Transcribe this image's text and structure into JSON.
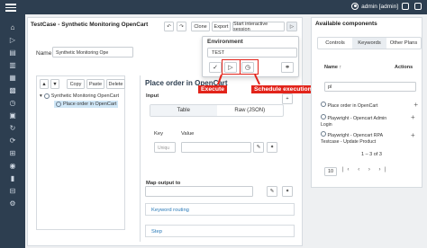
{
  "header": {
    "user": "admin [admin]"
  },
  "sidebar": {
    "icons": [
      "home-icon",
      "play-icon",
      "document-icon",
      "document-icon",
      "book-icon",
      "building-icon",
      "clock-icon",
      "database-icon",
      "loop-icon",
      "refresh-icon",
      "hierarchy-icon",
      "user-icon",
      "chart-icon",
      "grid-icon",
      "gear-icon"
    ]
  },
  "testcase": {
    "title": "TestCase - Synthetic Monitoring OpenCart",
    "toolbar": {
      "undo": "↶",
      "redo": "↷",
      "clone": "Clone",
      "export": "Export",
      "interactive": "Start interactive session",
      "play": "▷"
    },
    "name_label": "Name",
    "name_value": "Synthetic Monitoring Ope"
  },
  "tree": {
    "buttons": {
      "up": "▲",
      "down": "▼",
      "copy": "Copy",
      "paste": "Paste",
      "delete": "Delete"
    },
    "root": "Synthetic Monitoring OpenCart",
    "child": "Place order in OpenCart"
  },
  "editor": {
    "title": "Place order in OpenCart",
    "input_label": "Input",
    "tabs": [
      "Table",
      "Raw (JSON)"
    ],
    "key_header": "Key",
    "value_header": "Value",
    "key_placeholder": "Uniqu",
    "map_output_label": "Map output to",
    "keyword_routing": "Keyword routing",
    "step": "Step"
  },
  "environment": {
    "label": "Environment",
    "value": "TEST"
  },
  "annotations": {
    "execute": "Execute",
    "schedule": "Schedule execution"
  },
  "right_panel": {
    "title": "Available components",
    "tabs": [
      "Controls",
      "Keywords",
      "Other Plans"
    ],
    "name_col": "Name ↑",
    "actions_col": "Actions",
    "search_value": "pl",
    "items": [
      "Place order in OpenCart",
      "Playwright - Opencart Admin Login",
      "Playwright - Opencart RPA Testcase - Update Product"
    ],
    "pagination": {
      "range": "1 – 3 of 3",
      "rows_per_page": "10"
    }
  },
  "colors": {
    "nav": "#2d3e50",
    "annotation": "#e2231a",
    "link": "#2a7ab8"
  }
}
